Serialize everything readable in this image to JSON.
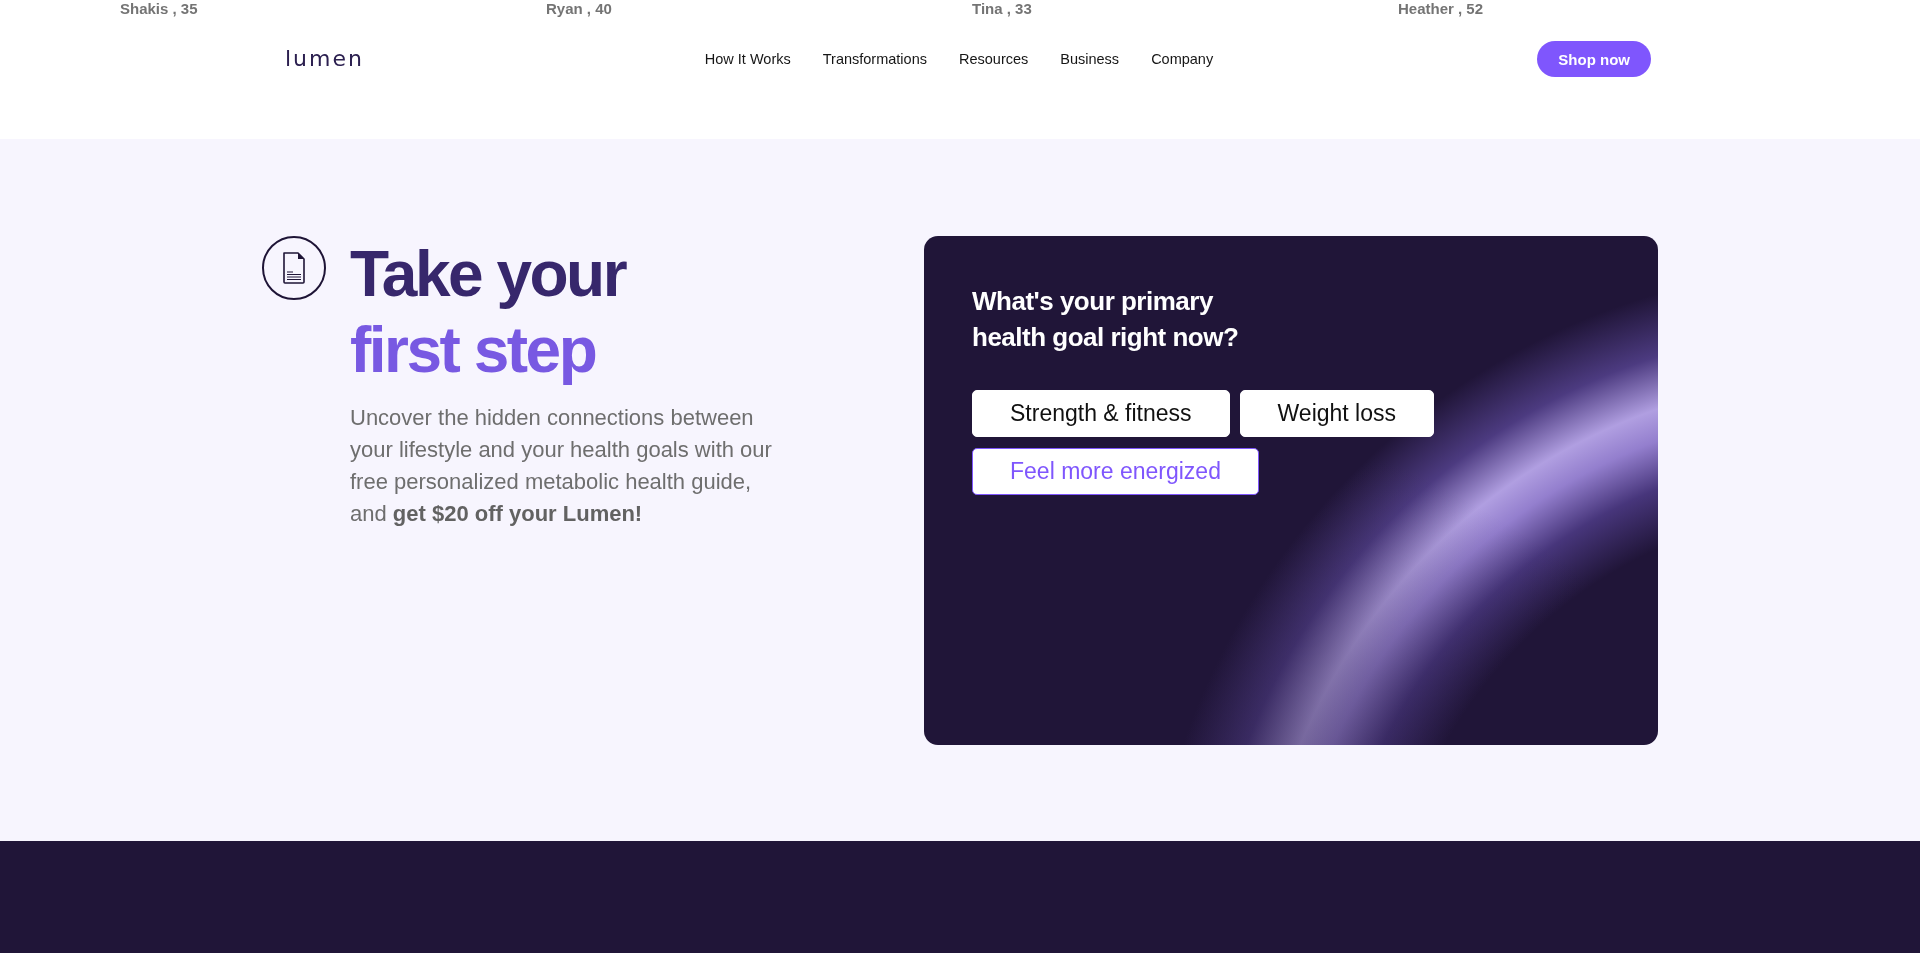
{
  "testimonial_captions": [
    "Shakis , 35",
    "Ryan , 40",
    "Tina , 33",
    "Heather , 52"
  ],
  "header": {
    "logo": "lumen",
    "nav": [
      {
        "label": "How It Works"
      },
      {
        "label": "Transformations"
      },
      {
        "label": "Resources"
      },
      {
        "label": "Business"
      },
      {
        "label": "Company"
      }
    ],
    "cta": "Shop now"
  },
  "hero": {
    "title_line_1": "Take your",
    "title_line_2": "first step",
    "description": "Uncover the hidden connections between your lifestyle and your health goals with our free personalized metabolic health guide, and **get $20 off your Lumen!**"
  },
  "quiz": {
    "question": "What's your primary health goal right now?",
    "options": [
      {
        "label": "Strength & fitness",
        "selected": false
      },
      {
        "label": "Weight loss",
        "selected": false
      },
      {
        "label": "Feel more energized",
        "selected": true
      }
    ]
  }
}
